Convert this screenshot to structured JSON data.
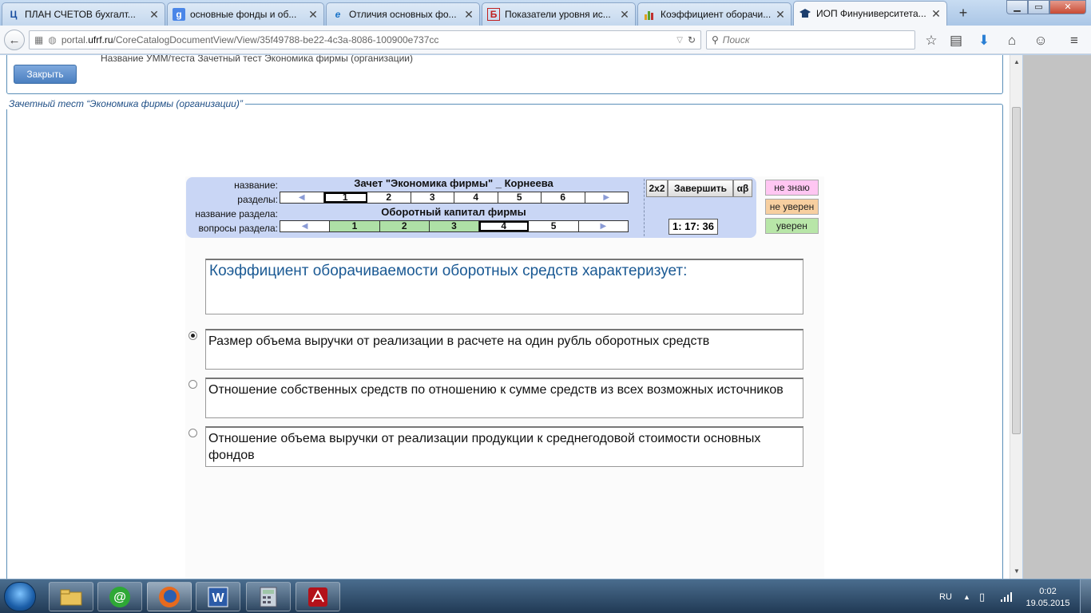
{
  "browser": {
    "tabs": [
      {
        "title": "ПЛАН СЧЕТОВ бухгалт...",
        "icon": "ц-logo",
        "icon_glyph": "Ц",
        "icon_color": "#1a4ea0"
      },
      {
        "title": "основные фонды и об...",
        "icon": "google-icon",
        "icon_glyph": "g",
        "icon_color": "#ffffff"
      },
      {
        "title": "Отличия основных фо...",
        "icon": "ie-icon",
        "icon_glyph": "e",
        "icon_color": "#1a73c8"
      },
      {
        "title": "Показатели уровня ис...",
        "icon": "b-logo",
        "icon_glyph": "Б",
        "icon_color": "#c02020"
      },
      {
        "title": "Коэффициент оборачи...",
        "icon": "chart-icon",
        "icon_glyph": "▮",
        "icon_color": "#5aa02c"
      },
      {
        "title": "ИОП Финуниверситета...",
        "icon": "graduation-cap-icon",
        "icon_glyph": "▰",
        "icon_color": "#1d3f6e"
      }
    ],
    "new_tab": "+",
    "url_prefix": "portal.",
    "url_host": "ufrf.ru",
    "url_path": "/CoreCatalogDocumentView/View/35f49788-be22-4c3a-8086-100900e737cc",
    "search_placeholder": "Поиск"
  },
  "page": {
    "top_text": "Название УММ/теста  Зачетный тест  Экономика фирмы (организации)",
    "close_button": "Закрыть",
    "legend": "Зачетный тест “Экономика фирмы (организации)”"
  },
  "test": {
    "name_label": "название:",
    "name_value": "Зачет \"Экономика фирмы\" _ Корнеева",
    "sections_label": "разделы:",
    "sections": [
      "1",
      "2",
      "3",
      "4",
      "5",
      "6"
    ],
    "selected_section": "1",
    "section_name_label": "название раздела:",
    "section_name_value": "Оборотный капитал фирмы",
    "questions_label": "вопросы раздела:",
    "questions": [
      "1",
      "2",
      "3",
      "4",
      "5"
    ],
    "answered_questions": [
      "1",
      "2",
      "3"
    ],
    "current_question": "4",
    "btn_2x2": "2x2",
    "btn_finish": "Завершить",
    "btn_alpha": "αβ",
    "timer": "1: 17: 36",
    "confidence": [
      {
        "label": "не знаю",
        "color": "#ffc6f2"
      },
      {
        "label": "не уверен",
        "color": "#f7cfa0"
      },
      {
        "label": "уверен",
        "color": "#b8e6a8"
      }
    ],
    "question": "Коэффициент  оборачиваемости оборотных  средств  характеризует:",
    "answers": [
      {
        "text": "Размер объема выручки от реализации в  расчете на один рубль оборотных средств",
        "selected": true
      },
      {
        "text": "Отношение  собственных  средств   по  отношению к сумме средств из всех возможных источников",
        "selected": false
      },
      {
        "text": "Отношение  объема  выручки от  реализации продукции к среднегодовой стоимости основных фондов",
        "selected": false
      }
    ]
  },
  "taskbar": {
    "apps": [
      "explorer-icon",
      "mail-ru-agent-icon",
      "firefox-icon",
      "word-icon",
      "calculator-icon",
      "acrobat-icon"
    ],
    "language": "RU",
    "time": "0:02",
    "date": "19.05.2015"
  }
}
